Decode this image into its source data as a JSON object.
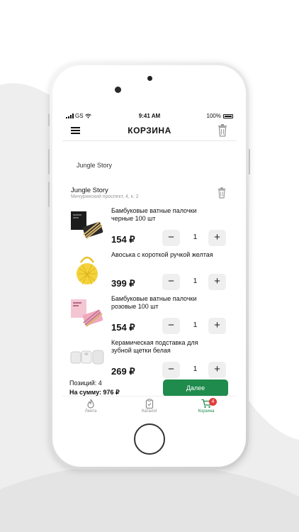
{
  "status_bar": {
    "carrier": "GS",
    "time": "9:41 AM",
    "battery": "100%"
  },
  "header": {
    "title": "КОРЗИНА"
  },
  "store_label": "Jungle Story",
  "shop": {
    "name": "Jungle Story",
    "address": "Мичуринский проспект, 4, к. 2"
  },
  "items": [
    {
      "name": "Бамбуковые ватные палочки черные 100 шт",
      "price": "154 ₽",
      "qty": "1"
    },
    {
      "name": "Авоська с короткой ручкой желтая",
      "price": "399 ₽",
      "qty": "1"
    },
    {
      "name": "Бамбуковые ватные палочки розовые 100 шт",
      "price": "154 ₽",
      "qty": "1"
    },
    {
      "name": "Керамическая подставка для зубной щетки белая",
      "price": "269 ₽",
      "qty": "1"
    }
  ],
  "controls": {
    "minus": "−",
    "plus": "+"
  },
  "summary": {
    "positions": "Позиций: 4",
    "total": "На сумму: 976 ₽"
  },
  "next_button": "Далее",
  "tabs": {
    "feed": "Лента",
    "catalog": "Каталог",
    "cart": "Корзина",
    "cart_badge": "4"
  },
  "colors": {
    "accent": "#1f8b4c",
    "badge": "#e23b3b"
  }
}
